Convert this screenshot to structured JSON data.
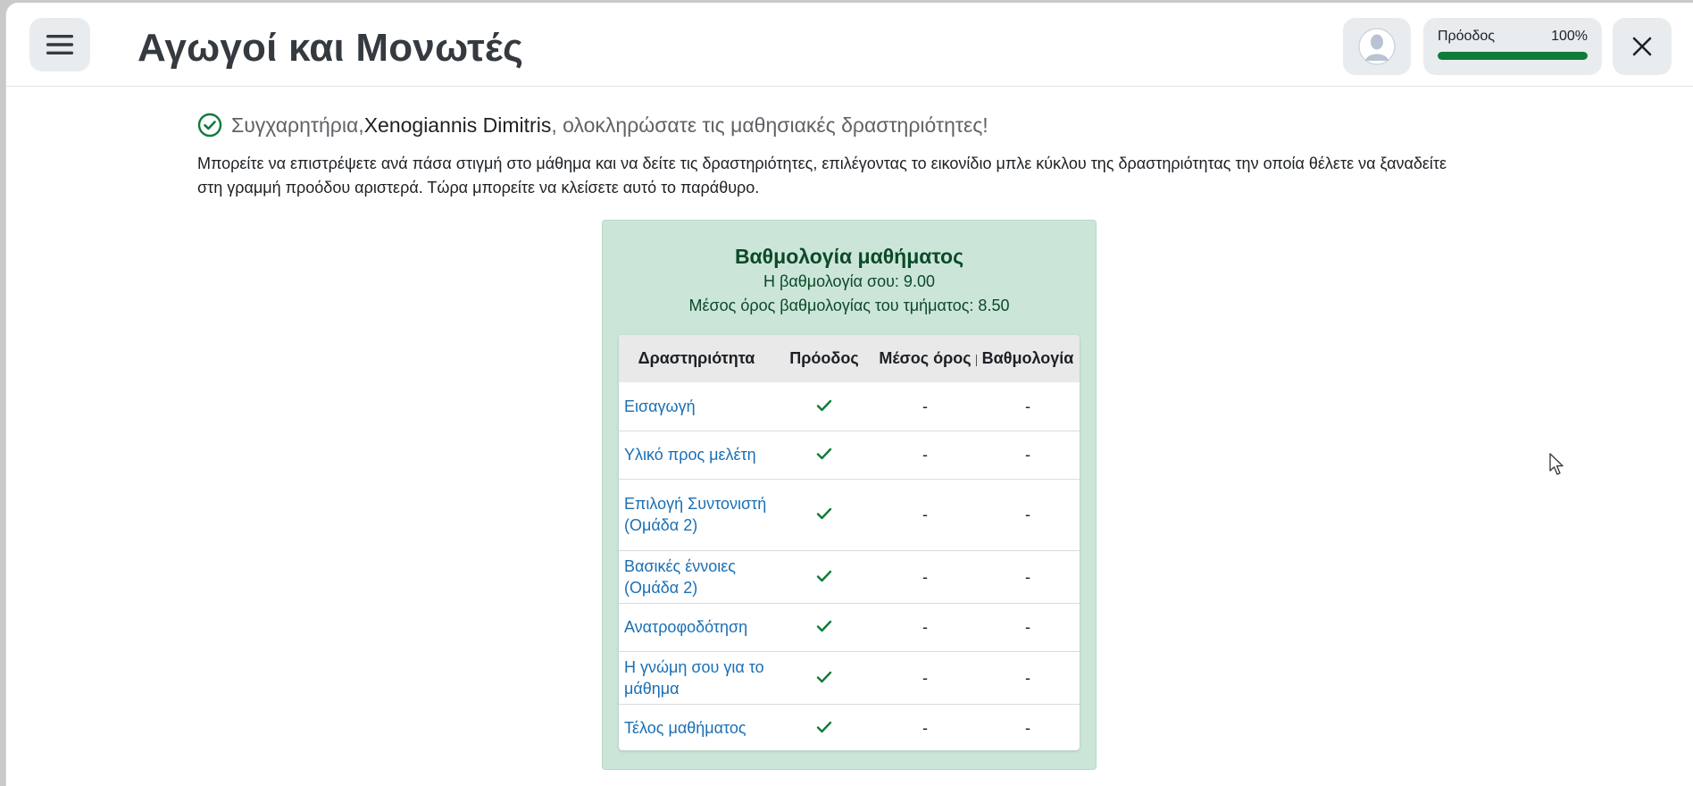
{
  "header": {
    "title": "Αγωγοί και Μονωτές",
    "progress_label": "Πρόοδος",
    "progress_value": "100%",
    "progress_fraction": 1.0
  },
  "congrats": {
    "prefix": "Συγχαρητήρια, ",
    "name": "Xenogiannis Dimitris",
    "suffix": ", ολοκληρώσατε τις μαθησιακές δραστηριότητες!"
  },
  "info": {
    "text": "Μπορείτε να επιστρέψετε ανά πάσα στιγμή στο μάθημα και να δείτε τις δραστηριότητες, επιλέγοντας το εικονίδιο μπλε κύκλου της δραστηριότητας την οποία θέλετε να ξαναδείτε στη γραμμή προόδου αριστερά. Τώρα μπορείτε να κλείσετε αυτό το παράθυρο."
  },
  "grade": {
    "title": "Βαθμολογία μαθήματος",
    "your_grade": "Η βαθμολογία σου: 9.00",
    "class_average": "Μέσος όρος βαθμολογίας του τμήματος: 8.50"
  },
  "table": {
    "headers": [
      "Δραστηριότητα",
      "Πρόοδος",
      "Μέσος όρος",
      "Βαθμολογία"
    ],
    "rows": [
      {
        "activity": "Εισαγωγή",
        "average": "-",
        "grade": "-"
      },
      {
        "activity": "Υλικό προς μελέτη",
        "average": "-",
        "grade": "-"
      },
      {
        "activity": "Επιλογή Συντονιστή (Ομάδα 2)",
        "average": "-",
        "grade": "-"
      },
      {
        "activity": "Βασικές έννοιες (Ομάδα 2)",
        "average": "-",
        "grade": "-"
      },
      {
        "activity": "Ανατροφοδότηση",
        "average": "-",
        "grade": "-"
      },
      {
        "activity": "Η γνώμη σου για το μάθημα",
        "average": "-",
        "grade": "-"
      },
      {
        "activity": "Τέλος μαθήματος",
        "average": "-",
        "grade": "-"
      }
    ]
  },
  "icons": {
    "menu": "hamburger-icon",
    "avatar": "user-avatar-icon",
    "close": "close-icon",
    "success": "check-circle-icon",
    "row_check": "check-icon"
  },
  "colors": {
    "success_green": "#0f7c3a",
    "card_bg": "#cce5d9",
    "link_blue": "#1a6fb5"
  }
}
